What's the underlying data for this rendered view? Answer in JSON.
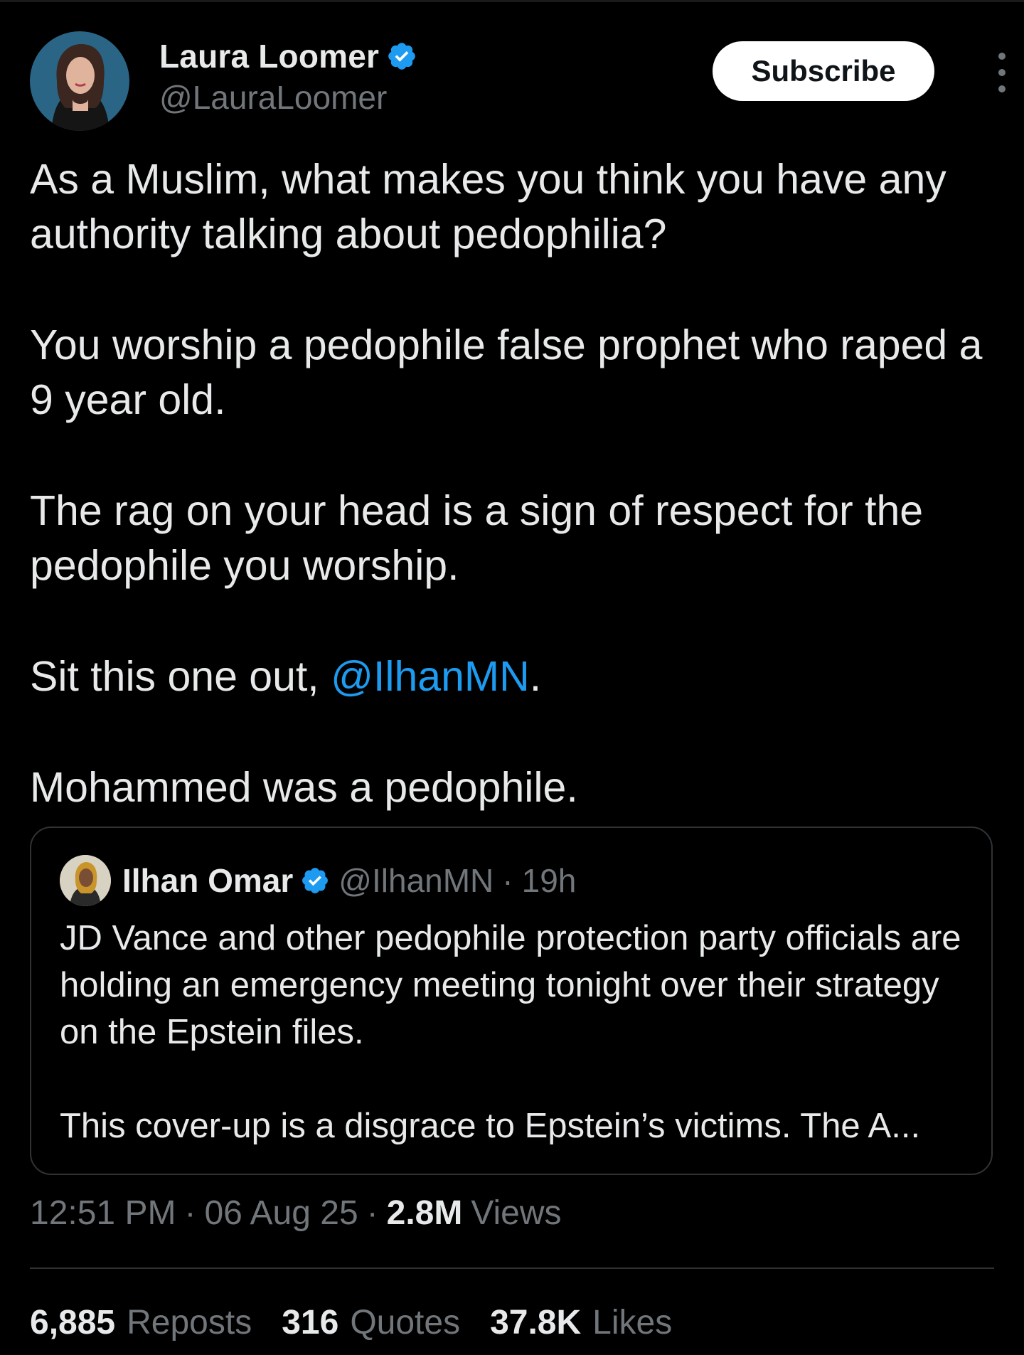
{
  "colors": {
    "background": "#000000",
    "text": "#e7e9ea",
    "secondary": "#71767b",
    "link": "#1d9bf0",
    "verified": "#1d9bf0",
    "border": "#2f3336"
  },
  "header": {
    "author_name": "Laura Loomer",
    "author_handle": "@LauraLoomer",
    "verified_icon": "verified-badge-icon",
    "subscribe_label": "Subscribe",
    "more_icon": "more-vertical-icon"
  },
  "tweet": {
    "p1": "As a Muslim, what makes you think you have any authority talking about pedophilia?",
    "p2": "You worship a pedophile false prophet who raped a 9 year old.",
    "p3": "The rag on your head is a sign of respect for the pedophile you worship.",
    "p4_prefix": "Sit this one out, ",
    "p4_mention": "@IlhanMN",
    "p4_suffix": ".",
    "p5": "Mohammed was a pedophile."
  },
  "quote": {
    "author_name": "Ilhan Omar",
    "author_handle": "@IlhanMN",
    "separator": "·",
    "time": "19h",
    "p1": "JD Vance and other pedophile protection party officials are holding an emergency meeting tonight over their strategy on the Epstein files.",
    "p2": "This cover-up is a disgrace to Epstein’s victims. The A..."
  },
  "meta": {
    "time": "12:51 PM",
    "separator": "·",
    "date": "06 Aug 25",
    "views_count": "2.8M",
    "views_label": "Views"
  },
  "stats": {
    "reposts_count": "6,885",
    "reposts_label": "Reposts",
    "quotes_count": "316",
    "quotes_label": "Quotes",
    "likes_count": "37.8K",
    "likes_label": "Likes"
  }
}
